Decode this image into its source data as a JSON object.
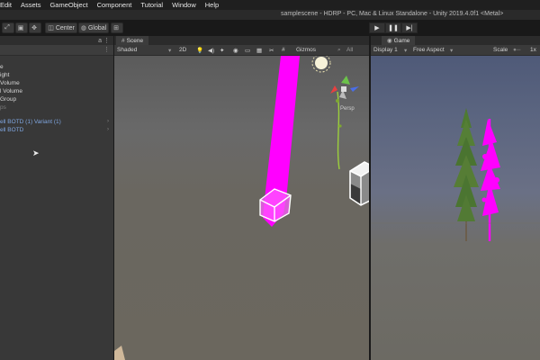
{
  "menubar": {
    "items": [
      "Edit",
      "Assets",
      "GameObject",
      "Component",
      "Tutorial",
      "Window",
      "Help"
    ]
  },
  "window": {
    "title": "samplescene - HDRP - PC, Mac & Linux Standalone - Unity 2019.4.0f1 <Metal>"
  },
  "toolbar": {
    "pivot_label": "Center",
    "space_label": "Global",
    "play_icon": "play-icon",
    "pause_icon": "pause-icon",
    "step_icon": "step-icon"
  },
  "hierarchy": {
    "header_icon": "a ⋮",
    "rows": [
      {
        "label": "e",
        "style": "normal"
      },
      {
        "label": "ight",
        "style": "normal"
      },
      {
        "label": "Volume",
        "style": "normal"
      },
      {
        "label": "l Volume",
        "style": "normal"
      },
      {
        "label": "Group",
        "style": "normal"
      },
      {
        "label": "ps",
        "style": "dim"
      },
      {
        "label": "",
        "style": "normal"
      },
      {
        "label": "ell BOTD (1) Variant (1)",
        "style": "blue"
      },
      {
        "label": "ell BOTD",
        "style": "blue"
      }
    ]
  },
  "scene": {
    "tab_label": "Scene",
    "shading_mode": "Shaded",
    "mode_2d": "2D",
    "gizmos_label": "Gizmos",
    "search_prefix": "All",
    "persp_label": "Persp"
  },
  "game": {
    "tab_label": "Game",
    "display": "Display 1",
    "aspect": "Free Aspect",
    "scale_label": "Scale",
    "scale_value": "1x"
  },
  "colors": {
    "magenta": "#ff00ff",
    "tree_green": "#4e7a32",
    "tree_trunk": "#6b5a44"
  }
}
